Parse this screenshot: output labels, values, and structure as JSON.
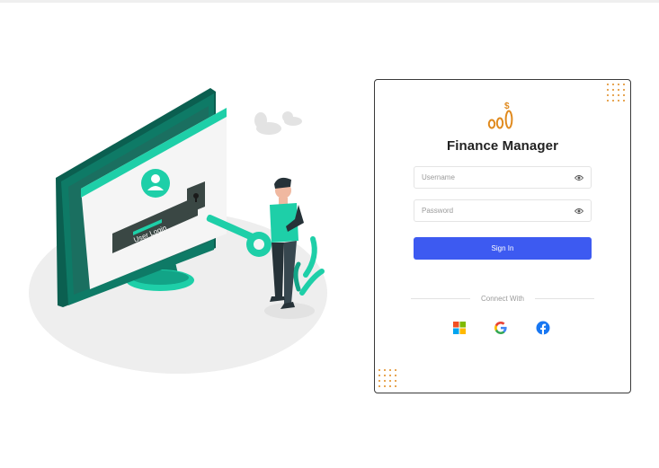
{
  "app": {
    "title": "Finance Manager"
  },
  "illustration": {
    "screen_label": "User Login"
  },
  "form": {
    "username": {
      "value": "",
      "placeholder": "Username"
    },
    "password": {
      "value": "",
      "placeholder": "Password"
    },
    "signin_label": "Sign In",
    "connect_with_label": "Connect With"
  },
  "social": [
    {
      "name": "microsoft-icon"
    },
    {
      "name": "google-icon"
    },
    {
      "name": "facebook-icon"
    }
  ],
  "colors": {
    "accent": "#3d5af1",
    "brand_logo": "#e08a1e",
    "illustration_teal": "#1ecfa8",
    "illustration_dark_teal": "#0e7a66"
  }
}
